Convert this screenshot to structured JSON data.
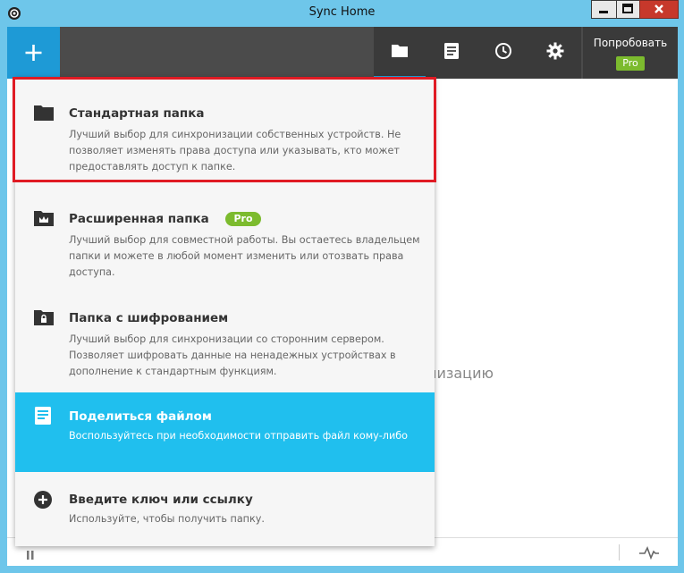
{
  "window": {
    "title": "Sync Home"
  },
  "toolbar": {
    "add_icon": "plus-icon",
    "tabs": [
      {
        "icon": "folder-icon",
        "active": true
      },
      {
        "icon": "document-icon",
        "active": false
      },
      {
        "icon": "clock-icon",
        "active": false
      },
      {
        "icon": "gear-icon",
        "active": false
      }
    ],
    "try_label": "Попробовать",
    "pro_label": "Pro"
  },
  "background_text": "низацию",
  "menu": {
    "items": [
      {
        "name": "Стандартная папка",
        "desc": "Лучший выбор для синхронизации собственных устройств. Не позволяет изменять права доступа или указывать, кто может предоставлять доступ к папке.",
        "icon": "folder-icon",
        "highlighted": true
      },
      {
        "name": "Расширенная папка",
        "badge": "Pro",
        "desc": "Лучший выбор для совместной работы. Вы остаетесь владельцем папки и можете в любой момент изменить или отозвать права доступа.",
        "icon": "folder-crown-icon"
      },
      {
        "name": "Папка с шифрованием",
        "desc": "Лучший выбор для синхронизации со сторонним сервером. Позволяет шифровать данные на ненадежных устройствах в дополнение к стандартным функциям.",
        "icon": "folder-lock-icon"
      },
      {
        "name": "Поделиться файлом",
        "desc": "Воспользуйтесь при необходимости отправить файл кому-либо",
        "icon": "file-icon",
        "selected": true
      },
      {
        "name": "Введите ключ или ссылку",
        "desc": "Используйте, чтобы получить папку.",
        "icon": "plus-circle-icon"
      }
    ]
  },
  "colors": {
    "titlebar": "#6ec6ea",
    "accent": "#1e9ad6",
    "selected": "#20bfee",
    "pro_green": "#7cbb2e",
    "toolbar": "#4b4b4b",
    "highlight_border": "#e01b24"
  }
}
